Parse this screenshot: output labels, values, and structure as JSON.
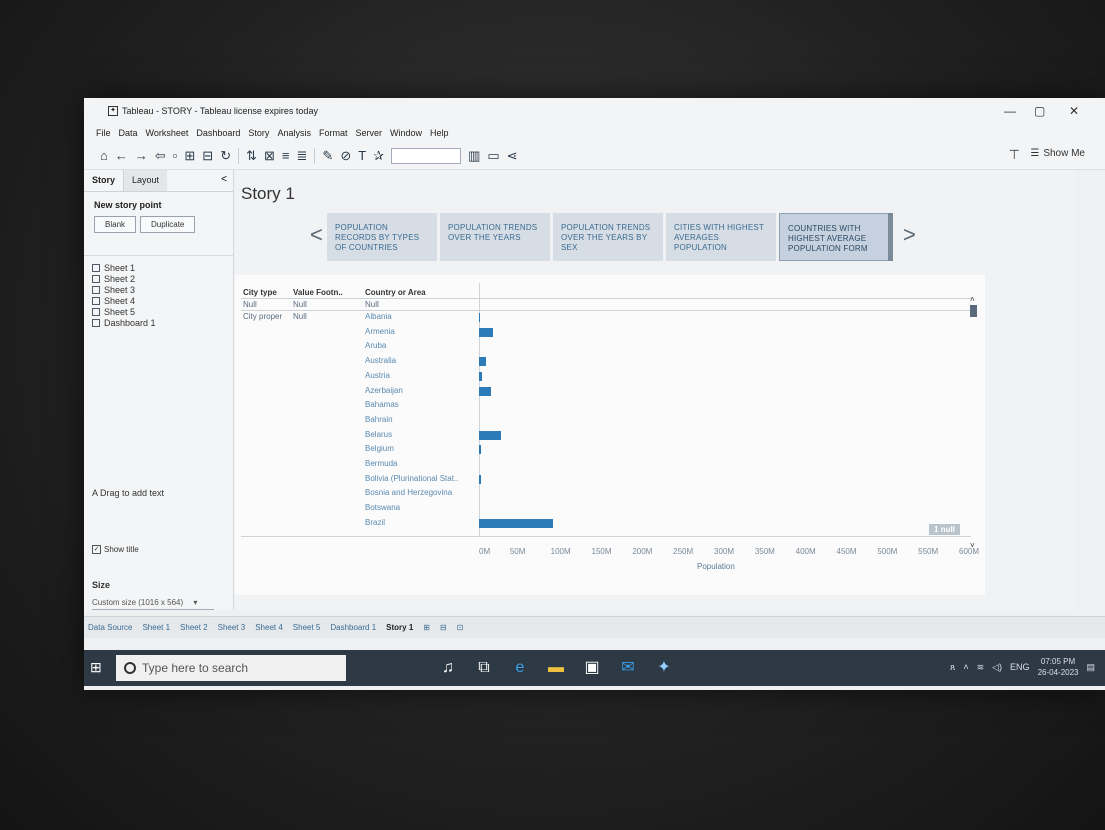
{
  "window": {
    "title": "Tableau - STORY - Tableau license expires today",
    "controls": [
      "—",
      "▢",
      "✕"
    ]
  },
  "menu": [
    "File",
    "Data",
    "Worksheet",
    "Dashboard",
    "Story",
    "Analysis",
    "Format",
    "Server",
    "Window",
    "Help"
  ],
  "toolbar": {
    "show_me_label": "Show Me"
  },
  "left_pane": {
    "tabs": {
      "story": "Story",
      "layout": "Layout"
    },
    "new_story_point": "New story point",
    "blank_button": "Blank",
    "duplicate_button": "Duplicate",
    "sheets": [
      "Sheet 1",
      "Sheet 2",
      "Sheet 3",
      "Sheet 4",
      "Sheet 5",
      "Dashboard 1"
    ],
    "drag_text": "A  Drag to add text",
    "show_title": "Show title",
    "size_heading": "Size",
    "size_value": "Custom size (1016 x 564)"
  },
  "story": {
    "title": "Story 1",
    "points": [
      "POPULATION RECORDS BY TYPES OF COUNTRIES",
      "POPULATION TRENDS OVER THE YEARS",
      "POPULATION TRENDS OVER THE YEARS BY SEX",
      "CITIES WITH HIGHEST AVERAGES POPULATION",
      "COUNTRIES WITH HIGHEST AVERAGE POPULATION FORM"
    ],
    "active_point_index": 4
  },
  "worksheet": {
    "headers": [
      "City type",
      "Value Footn..",
      "Country or Area"
    ],
    "null_row": [
      "Null",
      "Null",
      "Null"
    ],
    "city_type": "City proper",
    "value_footnote": "Null",
    "null_badge": "1 null"
  },
  "chart_data": {
    "type": "bar",
    "orientation": "horizontal",
    "categories": [
      "Albania",
      "Armenia",
      "Aruba",
      "Australia",
      "Austria",
      "Azerbaijan",
      "Bahamas",
      "Bahrain",
      "Belarus",
      "Belgium",
      "Bermuda",
      "Bolivia (Plurinational Stat..",
      "Bosnia and Herzegovina",
      "Botswana",
      "Brazil"
    ],
    "values": [
      1,
      17,
      0,
      8,
      4,
      15,
      0,
      0,
      27,
      3,
      0,
      2,
      0,
      0,
      90
    ],
    "xlabel": "Population",
    "xlim": [
      0,
      600
    ],
    "x_unit": "M",
    "x_ticks": [
      "0M",
      "50M",
      "100M",
      "150M",
      "200M",
      "250M",
      "300M",
      "350M",
      "400M",
      "450M",
      "500M",
      "550M",
      "600M"
    ],
    "bar_color": "#2b7bb9"
  },
  "bottom_tabs": [
    "Data Source",
    "Sheet 1",
    "Sheet 2",
    "Sheet 3",
    "Sheet 4",
    "Sheet 5",
    "Dashboard 1",
    "Story 1"
  ],
  "taskbar": {
    "search_placeholder": "Type here to search",
    "lang": "ENG",
    "time": "07:05 PM",
    "date": "26-04-2023"
  }
}
